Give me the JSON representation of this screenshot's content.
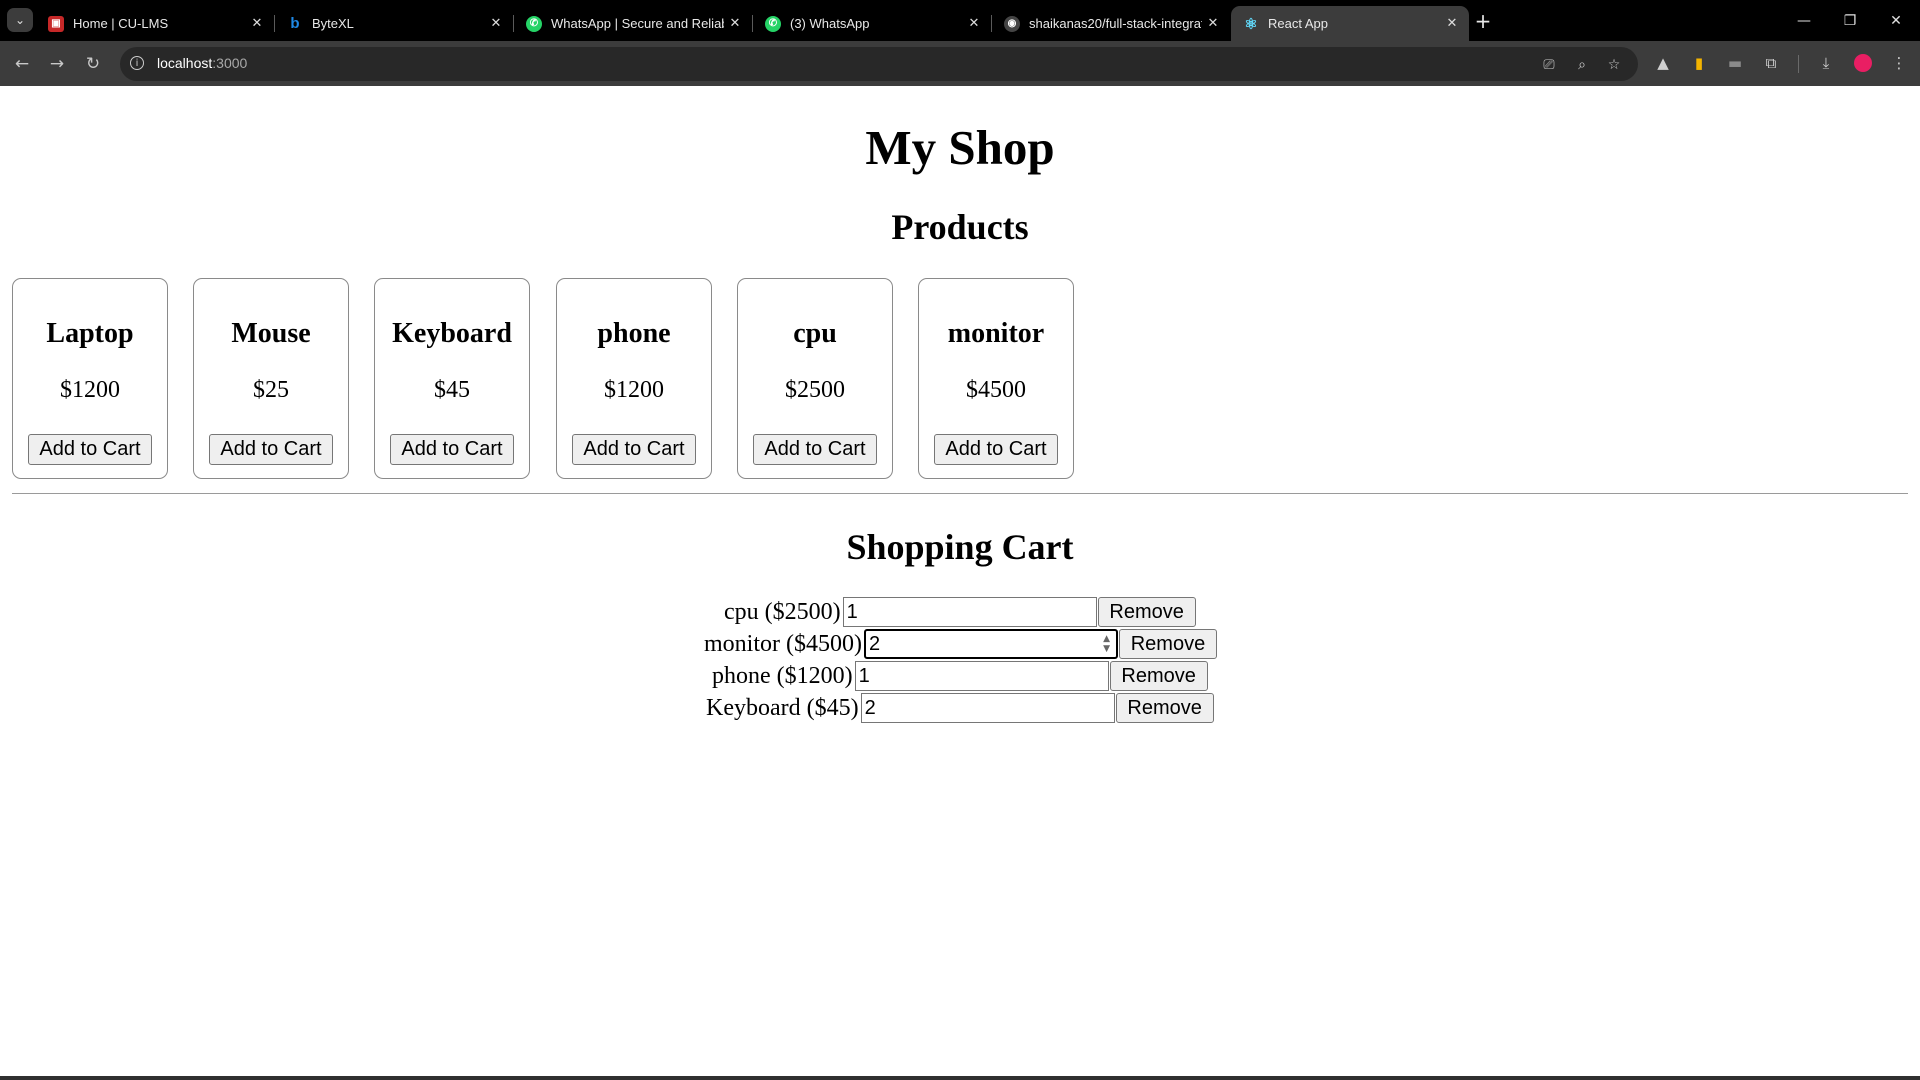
{
  "browser": {
    "tabs": [
      {
        "title": "Home | CU-LMS",
        "favicon_color": "#c62828",
        "favicon_glyph": "▣"
      },
      {
        "title": "ByteXL",
        "favicon_color": "#1e88e5",
        "favicon_glyph": "b"
      },
      {
        "title": "WhatsApp | Secure and Reliable",
        "favicon_color": "#25d366",
        "favicon_glyph": "✆"
      },
      {
        "title": "(3) WhatsApp",
        "favicon_color": "#25d366",
        "favicon_glyph": "✆"
      },
      {
        "title": "shaikanas20/full-stack-integrati",
        "favicon_color": "#444444",
        "favicon_glyph": "◉"
      },
      {
        "title": "React App",
        "favicon_color": "#61dafb",
        "favicon_glyph": "⚛",
        "active": true
      }
    ],
    "new_tab_glyph": "+",
    "url_host": "localhost",
    "url_port": ":3000"
  },
  "page": {
    "title": "My Shop",
    "products_heading": "Products",
    "products": [
      {
        "name": "Laptop",
        "price": "$1200",
        "button": "Add to Cart"
      },
      {
        "name": "Mouse",
        "price": "$25",
        "button": "Add to Cart"
      },
      {
        "name": "Keyboard",
        "price": "$45",
        "button": "Add to Cart"
      },
      {
        "name": "phone",
        "price": "$1200",
        "button": "Add to Cart"
      },
      {
        "name": "cpu",
        "price": "$2500",
        "button": "Add to Cart"
      },
      {
        "name": "monitor",
        "price": "$4500",
        "button": "Add to Cart"
      }
    ],
    "cart_heading": "Shopping Cart",
    "cart": [
      {
        "label": "cpu ($2500)",
        "quantity": "1",
        "remove": "Remove"
      },
      {
        "label": "monitor ($4500)",
        "quantity": "2",
        "remove": "Remove",
        "focused": true
      },
      {
        "label": "phone ($1200)",
        "quantity": "1",
        "remove": "Remove"
      },
      {
        "label": "Keyboard ($45)",
        "quantity": "2",
        "remove": "Remove"
      }
    ]
  }
}
